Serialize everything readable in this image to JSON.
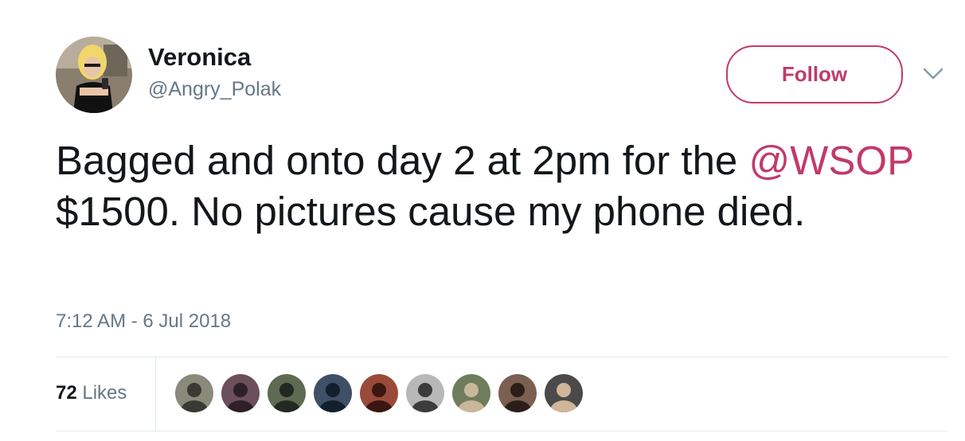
{
  "author": {
    "display_name": "Veronica",
    "handle": "@Angry_Polak",
    "avatar_icon": "profile-photo-icon"
  },
  "follow_button": {
    "label": "Follow"
  },
  "menu": {
    "icon": "chevron-down-icon"
  },
  "tweet": {
    "text_before_mention": "Bagged and onto day 2 at 2pm for the ",
    "mention": "@WSOP",
    "text_after_mention": " $1500. No pictures cause my phone died.",
    "timestamp": "7:12 AM - 6 Jul 2018"
  },
  "stats": {
    "likes_count": "72",
    "likes_label": "Likes"
  },
  "likers": [
    {
      "name": "liker-avatar-1",
      "bg": "#8a8a7a",
      "fg": "#3a3a34"
    },
    {
      "name": "liker-avatar-2",
      "bg": "#6b4f5a",
      "fg": "#2d2028"
    },
    {
      "name": "liker-avatar-3",
      "bg": "#5e6a52",
      "fg": "#232920"
    },
    {
      "name": "liker-avatar-4",
      "bg": "#3e4f66",
      "fg": "#12202e"
    },
    {
      "name": "liker-avatar-5",
      "bg": "#9a4a3a",
      "fg": "#3a1710"
    },
    {
      "name": "liker-avatar-6",
      "bg": "#b8b8b8",
      "fg": "#3c3c3c"
    },
    {
      "name": "liker-avatar-7",
      "bg": "#6f7d5c",
      "fg": "#c9b79c"
    },
    {
      "name": "liker-avatar-8",
      "bg": "#7a5f52",
      "fg": "#2b1e18"
    },
    {
      "name": "liker-avatar-9",
      "bg": "#4a4a4a",
      "fg": "#d0b59a"
    }
  ],
  "colors": {
    "accent": "#c13a6a",
    "text_primary": "#14171a",
    "text_secondary": "#657786",
    "divider": "#e1e8ed"
  }
}
